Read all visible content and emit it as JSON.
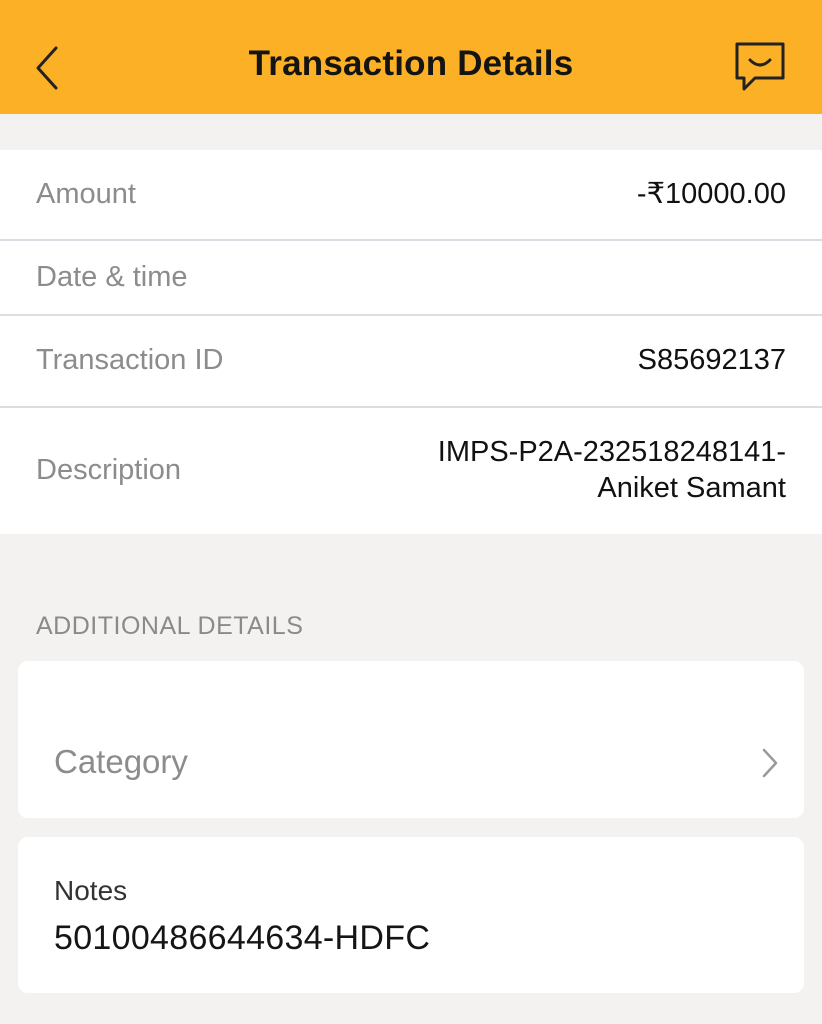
{
  "header": {
    "title": "Transaction Details",
    "back_icon": "chevron-left-icon",
    "chat_icon": "chat-bubble-icon",
    "background_color": "#fbb026"
  },
  "details": {
    "amount_label": "Amount",
    "amount_value": "-₹10000.00",
    "datetime_label": "Date & time",
    "datetime_value": "",
    "transaction_id_label": "Transaction ID",
    "transaction_id_value": "S85692137",
    "description_label": "Description",
    "description_line1": "IMPS-P2A-232518248141-",
    "description_line2": "Aniket Samant"
  },
  "additional": {
    "section_title": "ADDITIONAL DETAILS",
    "category_label": "Category",
    "category_icon": "chevron-right-icon",
    "notes_label": "Notes",
    "notes_value": "50100486644634-HDFC"
  }
}
